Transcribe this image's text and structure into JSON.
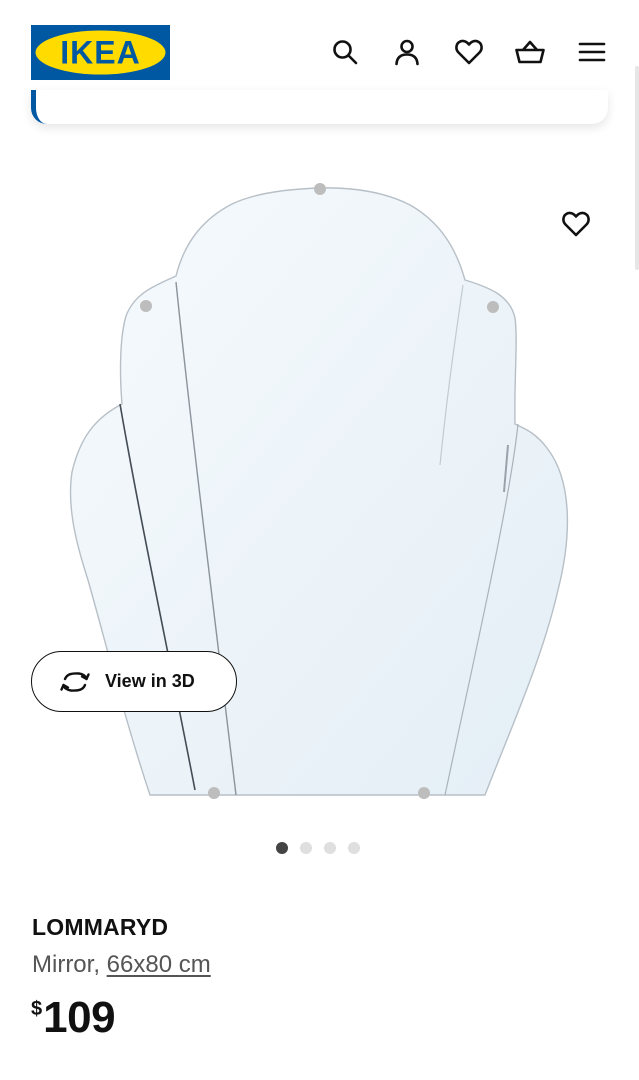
{
  "header": {
    "logo_text": "IKEA",
    "icons": [
      "search-icon",
      "account-icon",
      "heart-icon",
      "basket-icon",
      "menu-icon"
    ]
  },
  "colors": {
    "brand_blue": "#0058a3",
    "brand_yellow": "#ffdb00",
    "text_primary": "#111111",
    "text_secondary": "#555555",
    "dot_active": "#444444",
    "dot_inactive": "#dfdfdf"
  },
  "gallery": {
    "view3d_label": "View in 3D",
    "image_count": 4,
    "active_index": 0
  },
  "product": {
    "name": "LOMMARYD",
    "type": "Mirror,",
    "size": "66x80 cm",
    "currency": "$",
    "price": "109"
  }
}
